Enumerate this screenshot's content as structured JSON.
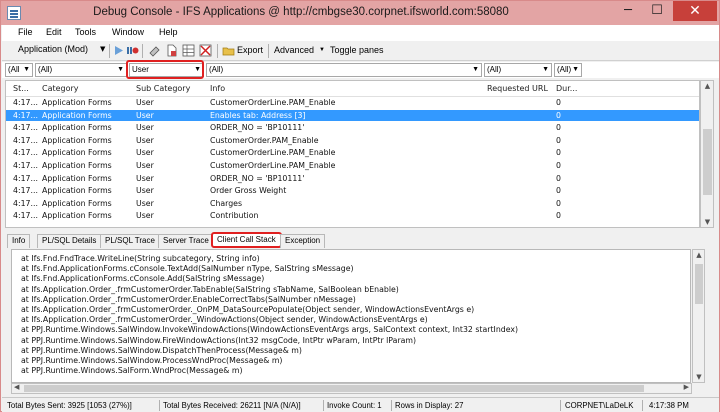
{
  "window": {
    "title": "Debug Console - IFS Applications @ http://cmbgse30.corpnet.ifsworld.com:58080",
    "min": "─",
    "max": "☐",
    "close": "✕"
  },
  "menu": [
    "File",
    "Edit",
    "Tools",
    "Window",
    "Help"
  ],
  "toolbar": {
    "mode": "Application (Mod)",
    "export": "Export",
    "advanced": "Advanced",
    "toggle": "Toggle panes"
  },
  "filters": {
    "status": "(All",
    "category": "(All)",
    "subcategory": "User",
    "info": "(All)",
    "url": "(All)",
    "duration": "(All)"
  },
  "grid": {
    "headers": [
      "St...",
      "Category",
      "Sub Category",
      "Info",
      "Requested URL",
      "Dur..."
    ],
    "selected_row": 1,
    "rows": [
      [
        "4:17...",
        "Application Forms",
        "User",
        "CustomerOrderLine.PAM_Enable",
        "",
        "0"
      ],
      [
        "4:17...",
        "Application Forms",
        "User",
        "Enables tab: Address [3]",
        "",
        "0"
      ],
      [
        "4:17...",
        "Application Forms",
        "User",
        "ORDER_NO = 'BP10111'",
        "",
        "0"
      ],
      [
        "4:17...",
        "Application Forms",
        "User",
        "CustomerOrder.PAM_Enable",
        "",
        "0"
      ],
      [
        "4:17...",
        "Application Forms",
        "User",
        "CustomerOrderLine.PAM_Enable",
        "",
        "0"
      ],
      [
        "4:17...",
        "Application Forms",
        "User",
        "CustomerOrderLine.PAM_Enable",
        "",
        "0"
      ],
      [
        "4:17...",
        "Application Forms",
        "User",
        "ORDER_NO = 'BP10111'",
        "",
        "0"
      ],
      [
        "4:17...",
        "Application Forms",
        "User",
        "Order Gross Weight",
        "",
        "0"
      ],
      [
        "4:17...",
        "Application Forms",
        "User",
        "Charges",
        "",
        "0"
      ],
      [
        "4:17...",
        "Application Forms",
        "User",
        "Contribution",
        "",
        "0"
      ]
    ]
  },
  "tabs": [
    "Info",
    "PL/SQL Details",
    "PL/SQL Trace",
    "Server Trace",
    "Client Call Stack",
    "Exception"
  ],
  "active_tab": 4,
  "stack_lines": [
    "at Ifs.Fnd.FndTrace.WriteLine(String subcategory, String info)",
    "at Ifs.Fnd.ApplicationForms.cConsole.TextAdd(SalNumber nType, SalString sMessage)",
    "at Ifs.Fnd.ApplicationForms.cConsole.Add(SalString sMessage)",
    "at Ifs.Application.Order_.frmCustomerOrder.TabEnable(SalString sTabName, SalBoolean bEnable)",
    "at Ifs.Application.Order_.frmCustomerOrder.EnableCorrectTabs(SalNumber nMessage)",
    "at Ifs.Application.Order_.frmCustomerOrder._OnPM_DataSourcePopulate(Object sender, WindowActionsEventArgs e)",
    "at Ifs.Application.Order_.frmCustomerOrder._WindowActions(Object sender, WindowActionsEventArgs e)",
    "at PPJ.Runtime.Windows.SalWindow.InvokeWindowActions(WindowActionsEventArgs args, SalContext context, Int32 startIndex)",
    "at PPJ.Runtime.Windows.SalWindow.FireWindowActions(Int32 msgCode, IntPtr wParam, IntPtr lParam)",
    "at PPJ.Runtime.Windows.SalWindow.DispatchThenProcess(Message& m)",
    "at PPJ.Runtime.Windows.SalWindow.ProcessWndProc(Message& m)",
    "at PPJ.Runtime.Windows.SalForm.WndProc(Message& m)"
  ],
  "status": {
    "sent": "Total Bytes Sent: 3925 [1053 (27%)]",
    "received": "Total Bytes Received: 26211 [N/A (N/A)]",
    "invoke": "Invoke Count: 1",
    "rows": "Rows in Display: 27",
    "user": "CORPNET\\LaDeLK",
    "time": "4:17:38 PM"
  },
  "colors": {
    "titlebar": "#e3a4a4",
    "selection": "#3399ff",
    "highlight": "#e02020"
  }
}
